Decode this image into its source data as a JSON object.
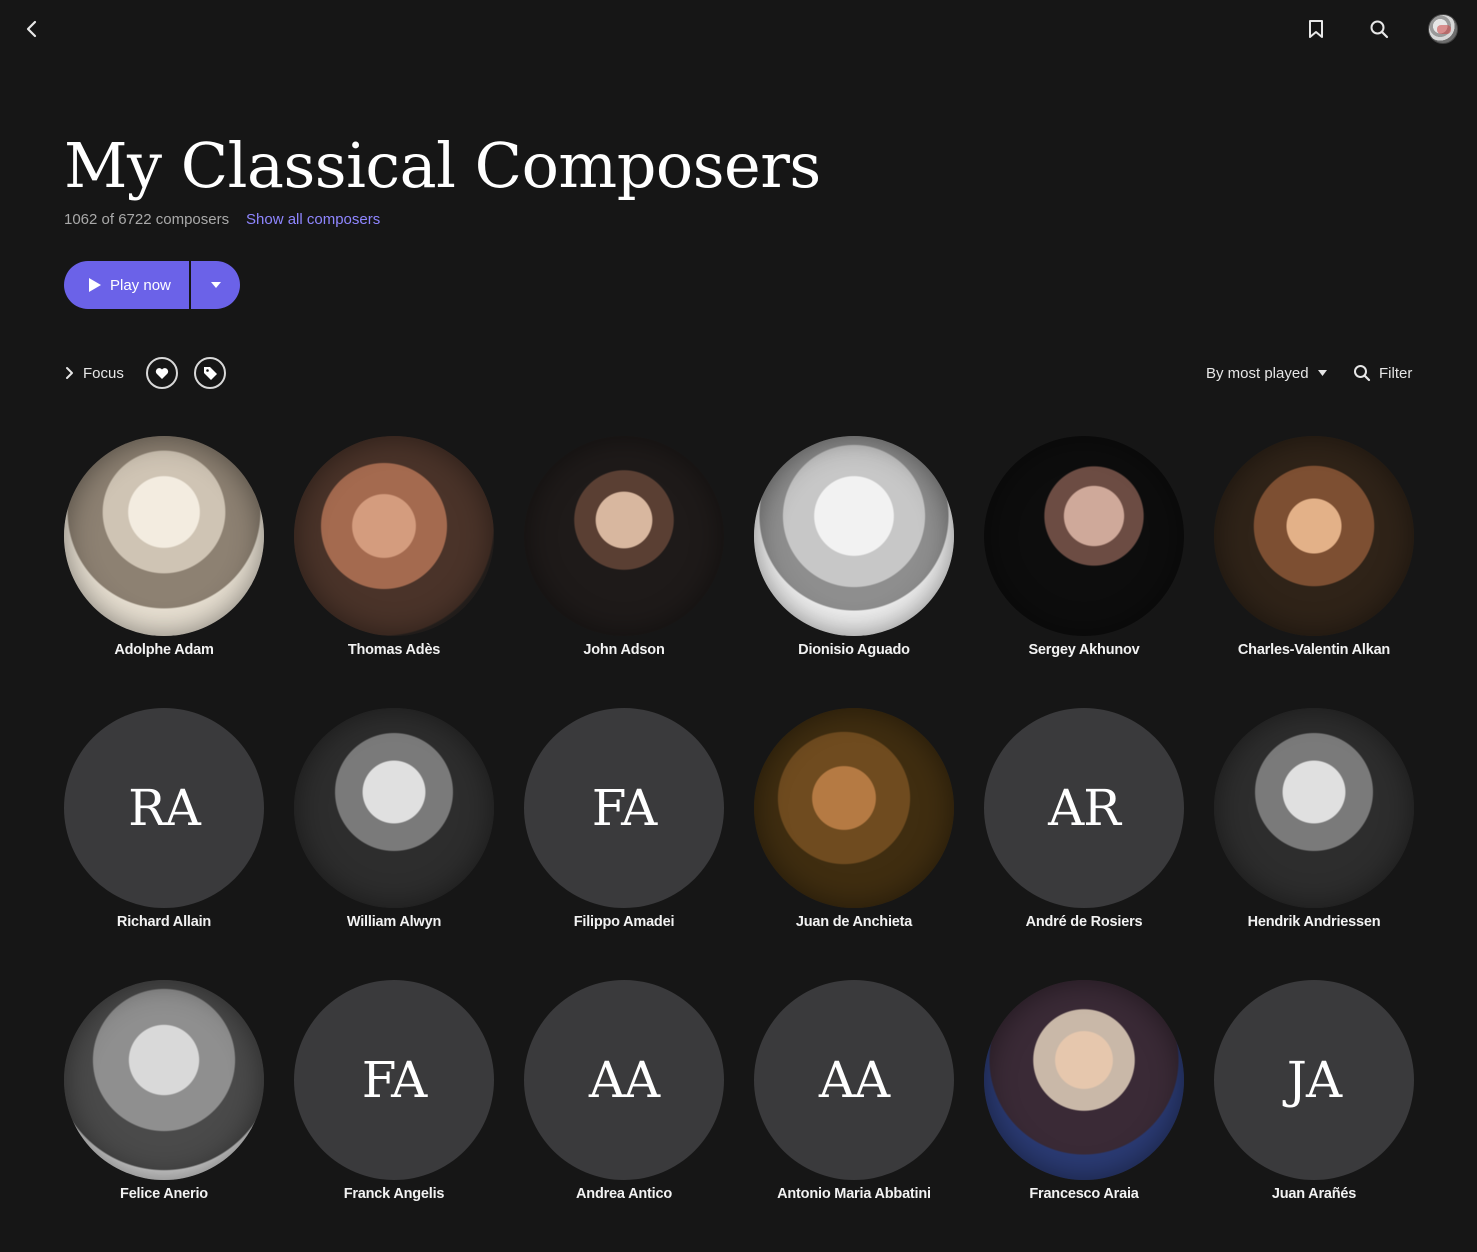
{
  "header": {
    "back_icon": "chevron-left-icon",
    "bookmark_icon": "bookmark-icon",
    "search_icon": "search-icon",
    "avatar_icon": "user-avatar"
  },
  "page": {
    "title": "My Classical Composers",
    "count_text": "1062 of 6722 composers",
    "show_all_label": "Show all composers",
    "accent_color": "#6b62e8",
    "link_color": "#8f86ff"
  },
  "actions": {
    "play_label": "Play now",
    "focus_label": "Focus",
    "sort_label": "By most played",
    "filter_label": "Filter"
  },
  "composers": [
    {
      "name": "Adolphe Adam",
      "initials": "",
      "style": "p-sepia"
    },
    {
      "name": "Thomas Adès",
      "initials": "",
      "style": "p-warm"
    },
    {
      "name": "John Adson",
      "initials": "",
      "style": "p-dark"
    },
    {
      "name": "Dionisio Aguado",
      "initials": "",
      "style": "p-sketch"
    },
    {
      "name": "Sergey Akhunov",
      "initials": "",
      "style": "p-black"
    },
    {
      "name": "Charles-Valentin Alkan",
      "initials": "",
      "style": "p-oil"
    },
    {
      "name": "Richard Allain",
      "initials": "RA",
      "style": ""
    },
    {
      "name": "William Alwyn",
      "initials": "",
      "style": "p-bw"
    },
    {
      "name": "Filippo Amadei",
      "initials": "FA",
      "style": ""
    },
    {
      "name": "Juan de Anchieta",
      "initials": "",
      "style": "p-gold"
    },
    {
      "name": "André de Rosiers",
      "initials": "AR",
      "style": ""
    },
    {
      "name": "Hendrik Andriessen",
      "initials": "",
      "style": "p-bw"
    },
    {
      "name": "Felice Anerio",
      "initials": "",
      "style": "p-engr"
    },
    {
      "name": "Franck Angelis",
      "initials": "FA",
      "style": ""
    },
    {
      "name": "Andrea Antico",
      "initials": "AA",
      "style": ""
    },
    {
      "name": "Antonio Maria Abbatini",
      "initials": "AA",
      "style": ""
    },
    {
      "name": "Francesco Araia",
      "initials": "",
      "style": "p-baroque"
    },
    {
      "name": "Juan Arañés",
      "initials": "JA",
      "style": ""
    }
  ]
}
